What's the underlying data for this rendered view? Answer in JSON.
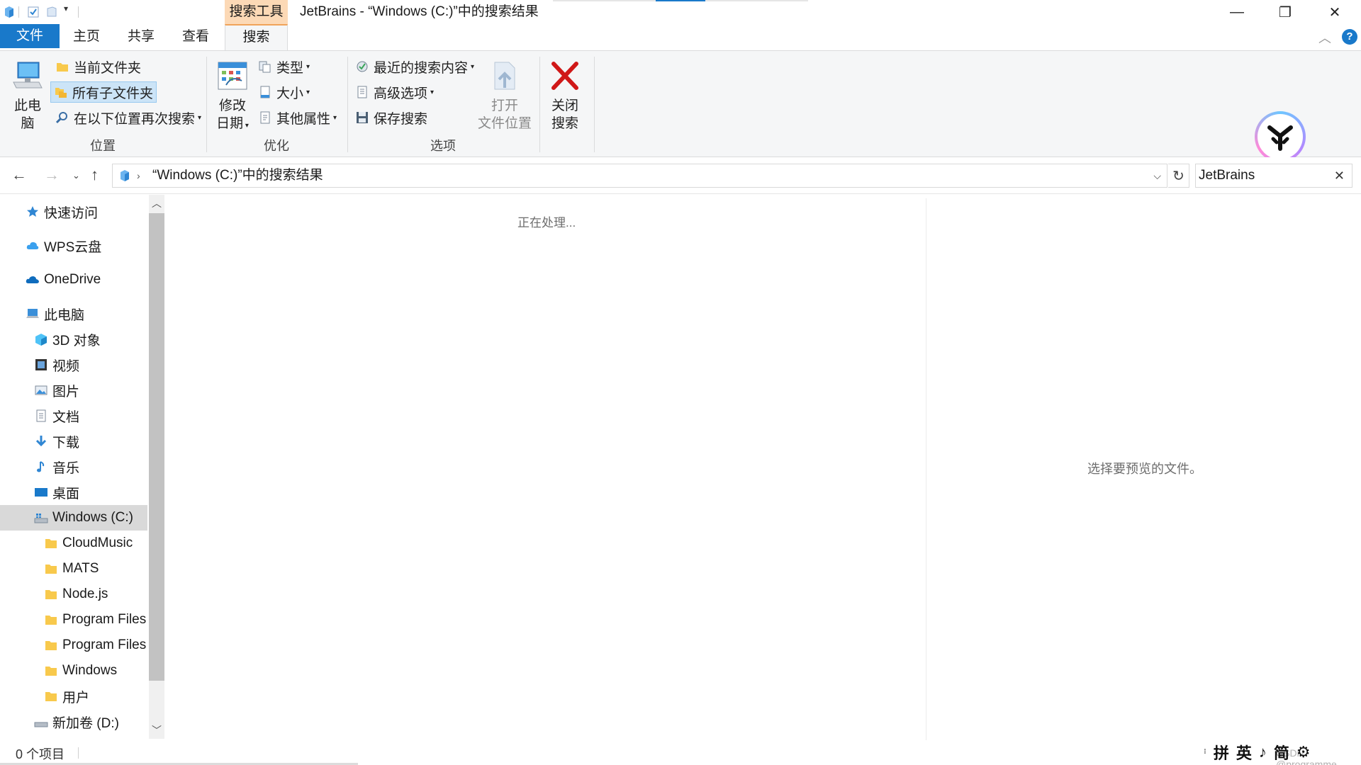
{
  "window": {
    "title": "JetBrains - “Windows (C:)”中的搜索结果",
    "context_tab_group": "搜索工具",
    "minimize": "—",
    "restore": "❐",
    "close": "✕"
  },
  "tabs": {
    "file": "文件",
    "home": "主页",
    "share": "共享",
    "view": "查看",
    "search": "搜索"
  },
  "ribbon": {
    "location": {
      "label": "位置",
      "this_pc_line1": "此电",
      "this_pc_line2": "脑",
      "current_folder": "当前文件夹",
      "all_subfolders": "所有子文件夹",
      "search_again_in": "在以下位置再次搜索"
    },
    "refine": {
      "label": "优化",
      "date_modified_line1": "修改",
      "date_modified_line2": "日期",
      "type": "类型",
      "size": "大小",
      "other_properties": "其他属性"
    },
    "options": {
      "label": "选项",
      "recent_searches": "最近的搜索内容",
      "advanced_options": "高级选项",
      "save_search": "保存搜索",
      "open_location_line1": "打开",
      "open_location_line2": "文件位置"
    },
    "close_search_line1": "关闭",
    "close_search_line2": "搜索"
  },
  "address": {
    "path": "“Windows (C:)”中的搜索结果",
    "search_value": "JetBrains"
  },
  "nav": {
    "items": [
      {
        "label": "快速访问",
        "icon": "star-icon"
      },
      {
        "label": "WPS云盘",
        "icon": "cloud-icon"
      },
      {
        "label": "OneDrive",
        "icon": "onedrive-icon"
      },
      {
        "label": "此电脑",
        "icon": "computer-icon"
      },
      {
        "label": "3D 对象",
        "icon": "cube-icon"
      },
      {
        "label": "视频",
        "icon": "video-icon"
      },
      {
        "label": "图片",
        "icon": "picture-icon"
      },
      {
        "label": "文档",
        "icon": "document-icon"
      },
      {
        "label": "下载",
        "icon": "download-icon"
      },
      {
        "label": "音乐",
        "icon": "music-icon"
      },
      {
        "label": "桌面",
        "icon": "desktop-icon"
      },
      {
        "label": "Windows (C:)",
        "icon": "drive-icon"
      },
      {
        "label": "CloudMusic",
        "icon": "folder-icon"
      },
      {
        "label": "MATS",
        "icon": "folder-icon"
      },
      {
        "label": "Node.js",
        "icon": "folder-icon"
      },
      {
        "label": "Program Files",
        "icon": "folder-icon"
      },
      {
        "label": "Program Files",
        "icon": "folder-icon"
      },
      {
        "label": "Windows",
        "icon": "folder-icon"
      },
      {
        "label": "用户",
        "icon": "folder-icon"
      },
      {
        "label": "新加卷 (D:)",
        "icon": "drive-icon"
      }
    ]
  },
  "content": {
    "status": "正在处理..."
  },
  "preview": {
    "message": "选择要预览的文件。"
  },
  "statusbar": {
    "item_count": "0 个项目",
    "ime": [
      "拼",
      "英",
      "♪",
      "简",
      "⚙"
    ],
    "watermark": "CSDN @programme"
  },
  "colors": {
    "accent": "#1979ca",
    "context_tab": "#fcd9b6",
    "close_search_x": "#d01818"
  }
}
